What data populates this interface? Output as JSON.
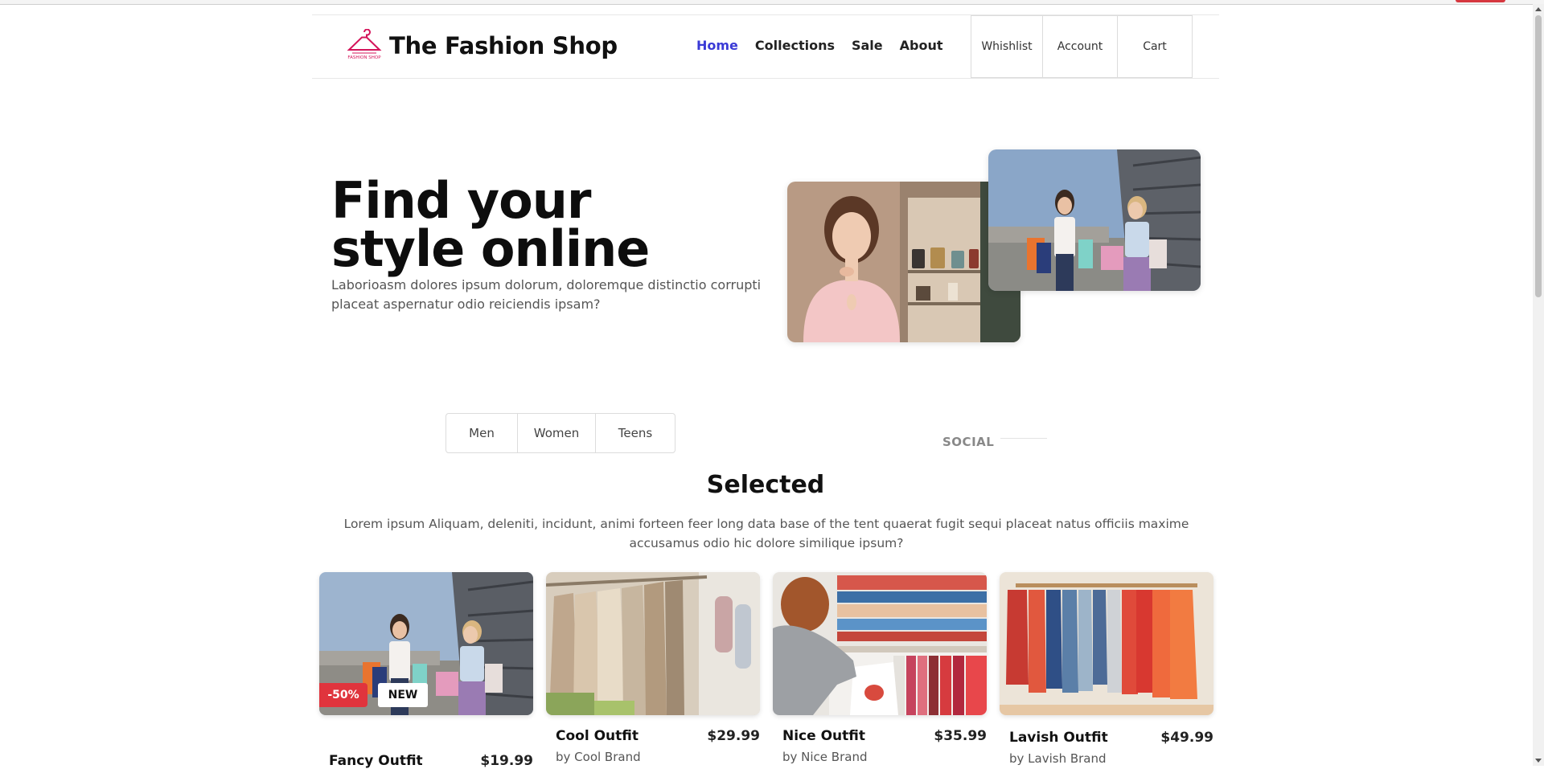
{
  "brand": {
    "name": "The Fashion Shop",
    "logo_icon": "hanger-icon",
    "logo_small_text": "FASHION SHOP"
  },
  "nav": {
    "items": [
      {
        "label": "Home",
        "active": true
      },
      {
        "label": "Collections",
        "active": false
      },
      {
        "label": "Sale",
        "active": false
      },
      {
        "label": "About",
        "active": false
      }
    ]
  },
  "utils": {
    "wishlist": "Whishlist",
    "account": "Account",
    "cart": "Cart"
  },
  "hero": {
    "title_line1": "Find your",
    "title_line2": "style online",
    "subtitle": "Laborioasm dolores ipsum dolorum, doloremque distinctio corrupti placeat aspernatur odio reiciendis ipsam?"
  },
  "categories": {
    "tabs": [
      "Men",
      "Women",
      "Teens"
    ]
  },
  "social": {
    "label": "SOCIAL"
  },
  "selected": {
    "title": "Selected",
    "description": "Lorem ipsum Aliquam, deleniti, incidunt, animi forteen feer long data base of the tent quaerat fugit sequi placeat natus officiis maxime accusamus odio hic dolore similique ipsum?"
  },
  "products": [
    {
      "name": "Fancy Outfit",
      "price": "$19.99",
      "brand": "",
      "badges": [
        "-50%",
        "NEW"
      ]
    },
    {
      "name": "Cool Outfit",
      "price": "$29.99",
      "brand": "by Cool Brand",
      "badges": []
    },
    {
      "name": "Nice Outfit",
      "price": "$35.99",
      "brand": "by Nice Brand",
      "badges": []
    },
    {
      "name": "Lavish Outfit",
      "price": "$49.99",
      "brand": "by Lavish Brand",
      "badges": []
    }
  ],
  "colors": {
    "accent": "#3a3ad6",
    "sale_badge": "#e0343d",
    "logo": "#d4145a"
  }
}
